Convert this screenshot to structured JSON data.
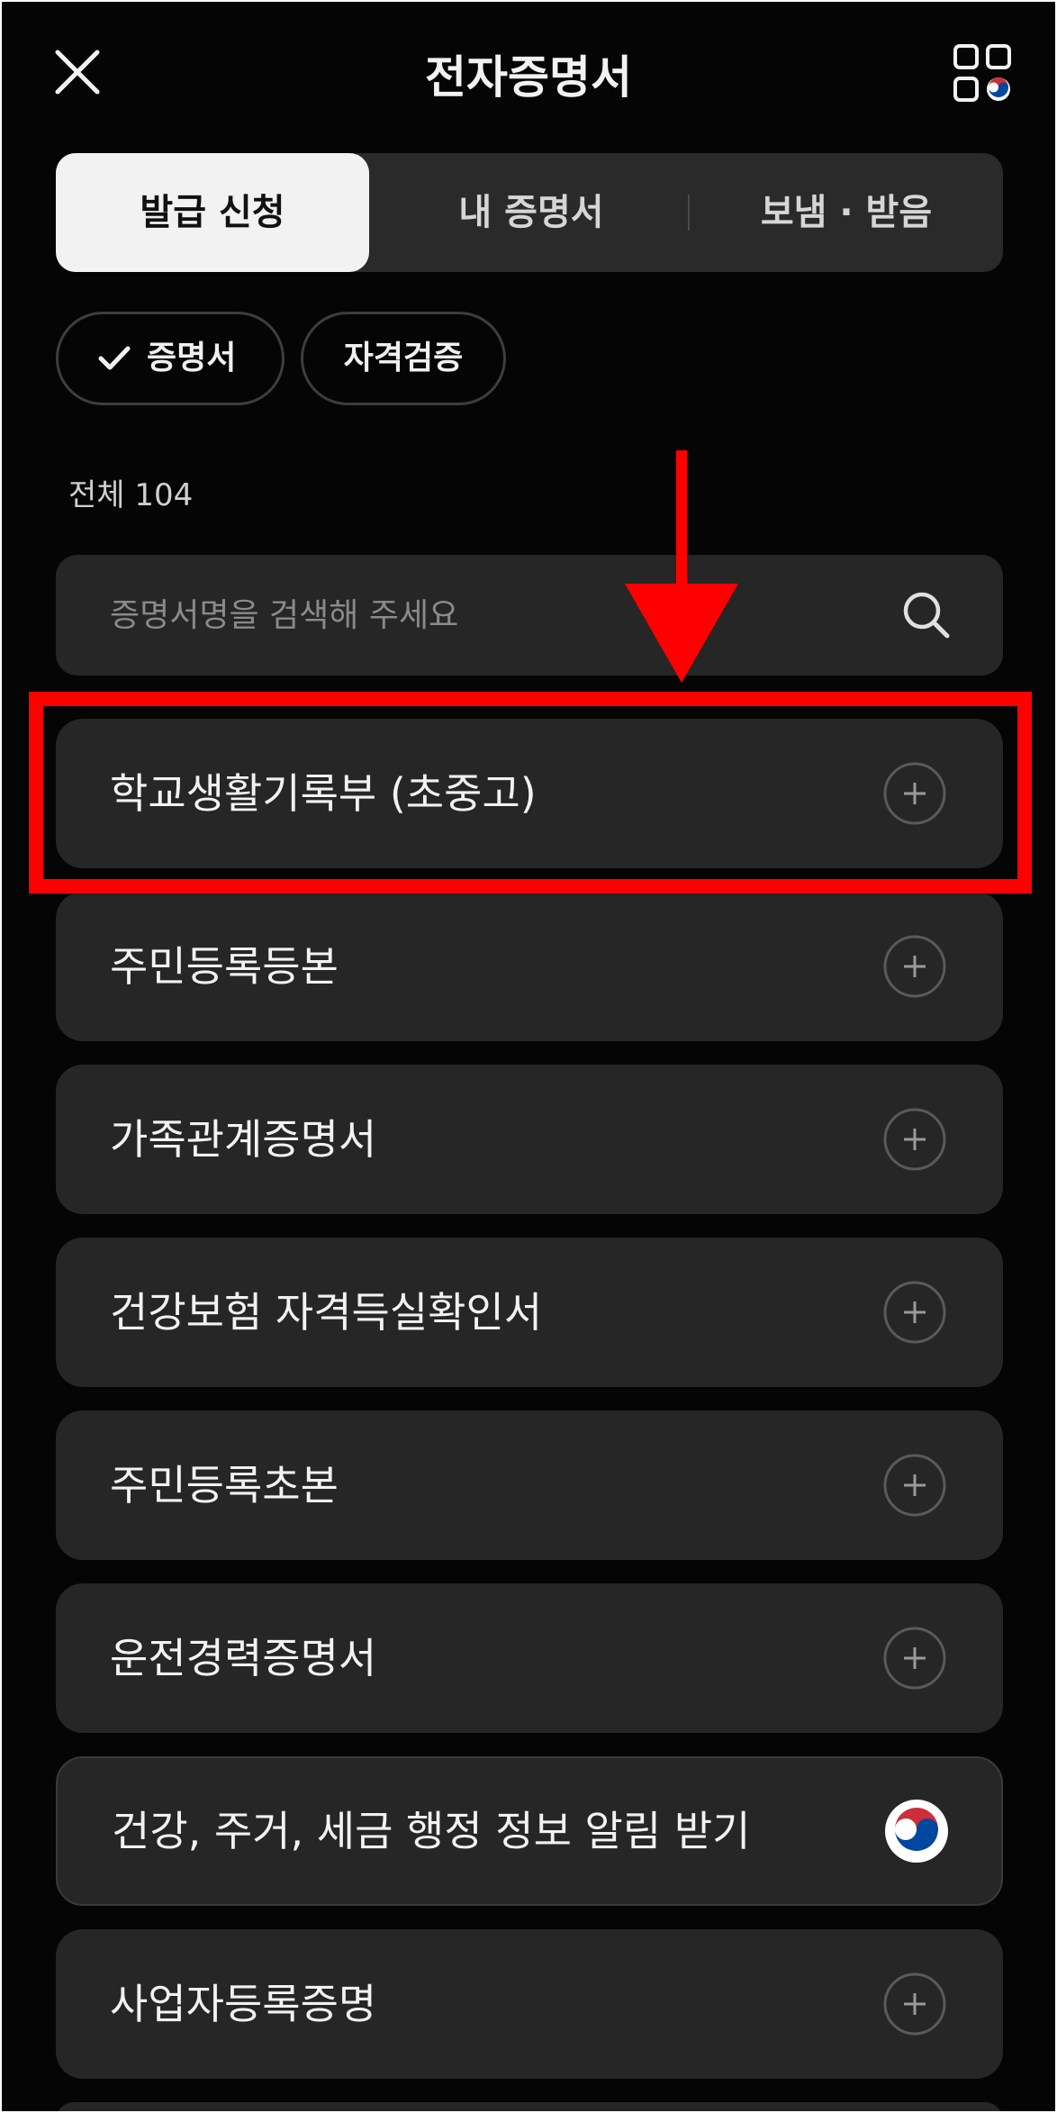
{
  "header": {
    "title": "전자증명서"
  },
  "tabs": [
    {
      "label": "발급 신청",
      "active": true
    },
    {
      "label": "내 증명서",
      "active": false
    },
    {
      "label": "보냄 · 받음",
      "active": false
    }
  ],
  "filters": [
    {
      "label": "증명서",
      "selected": true
    },
    {
      "label": "자격검증",
      "selected": false
    }
  ],
  "count_label": "전체 104",
  "search": {
    "placeholder": "증명서명을 검색해 주세요",
    "value": ""
  },
  "items": [
    {
      "label": "학교생활기록부 (초중고)",
      "icon": "plus-circle-icon"
    },
    {
      "label": "주민등록등본",
      "icon": "plus-circle-icon"
    },
    {
      "label": "가족관계증명서",
      "icon": "plus-circle-icon"
    },
    {
      "label": "건강보험 자격득실확인서",
      "icon": "plus-circle-icon"
    },
    {
      "label": "주민등록초본",
      "icon": "plus-circle-icon"
    },
    {
      "label": "운전경력증명서",
      "icon": "plus-circle-icon"
    },
    {
      "label": "건강, 주거, 세금 행정 정보 알림 받기",
      "icon": "government-emblem-icon"
    },
    {
      "label": "사업자등록증명",
      "icon": "plus-circle-icon"
    }
  ],
  "annotation": {
    "highlight_color": "#ff0000",
    "target_item": "학교생활기록부 (초중고)"
  },
  "colors": {
    "background": "#050505",
    "card": "#262626",
    "active_tab": "#f2f2f2",
    "text": "#f2f2f2",
    "annotation": "#ff0000"
  }
}
